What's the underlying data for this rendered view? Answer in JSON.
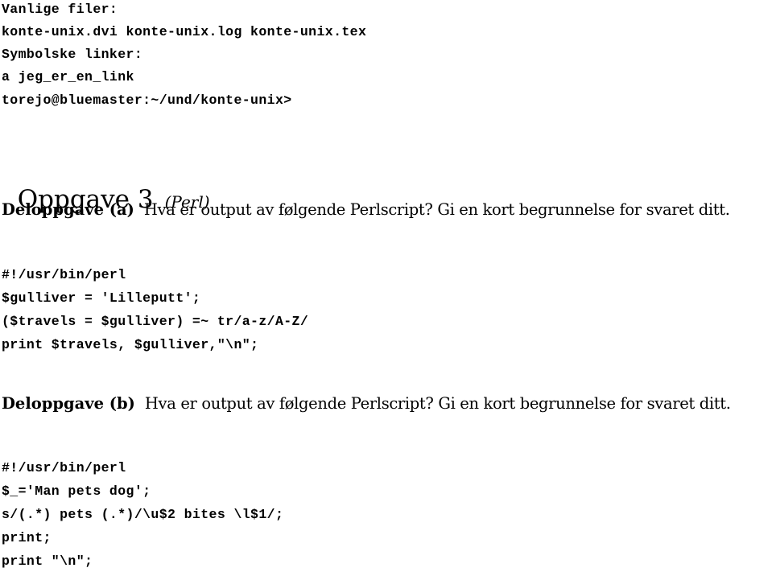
{
  "terminal": {
    "lines": [
      "Vanlige filer:",
      "konte-unix.dvi konte-unix.log konte-unix.tex",
      "Symbolske linker:",
      "a jeg_er_en_link",
      "torejo@bluemaster:~/und/konte-unix>"
    ]
  },
  "task": {
    "title": "Oppgave 3",
    "topic": "(Perl)"
  },
  "subtasks": [
    {
      "label": "Deloppgave (a)",
      "question": "Hva er output av følgende Perlscript? Gi en kort begrunnelse for svaret ditt.",
      "code": [
        "#!/usr/bin/perl",
        "$gulliver = 'Lilleputt';",
        "($travels = $gulliver) =~ tr/a-z/A-Z/",
        "print $travels, $gulliver,\"\\n\";"
      ]
    },
    {
      "label": "Deloppgave (b)",
      "question": "Hva er output av følgende Perlscript? Gi en kort begrunnelse for svaret ditt.",
      "code": [
        "#!/usr/bin/perl",
        "$_='Man pets dog';",
        "s/(.*) pets (.*)/\\u$2 bites \\l$1/;",
        "print;",
        "print \"\\n\";"
      ]
    }
  ]
}
